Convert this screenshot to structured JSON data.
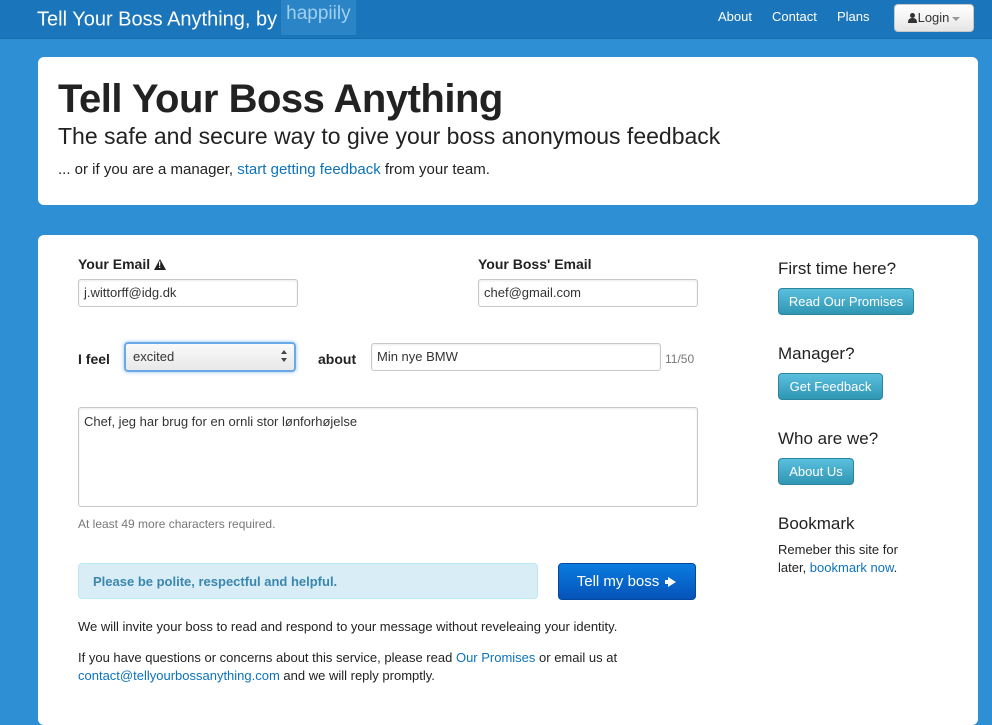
{
  "navbar": {
    "brand_text": "Tell Your Boss Anything, by",
    "brand_logo": "happiily",
    "links": [
      "About",
      "Contact",
      "Plans"
    ],
    "login_label": "Login"
  },
  "hero": {
    "title": "Tell Your Boss Anything",
    "subtitle": "The safe and secure way to give your boss anonymous feedback",
    "manager_prefix": "... or if you are a manager, ",
    "manager_link": "start getting feedback",
    "manager_suffix": " from your team."
  },
  "form": {
    "email_label": "Your Email",
    "email_value": "j.wittorff@idg.dk",
    "boss_email_label": "Your Boss' Email",
    "boss_email_value": "chef@gmail.com",
    "feel_label": "I feel",
    "feel_value": "excited",
    "about_label": "about",
    "about_value": "Min nye BMW",
    "char_count": "11/50",
    "message_value": "Chef, jeg har brug for en ornli stor lønforhøjelse",
    "min_chars_note": "At least 49 more characters required.",
    "alert_text": "Please be polite, respectful and helpful.",
    "submit_label": "Tell my boss",
    "invite_text": "We will invite your boss to read and respond to your message without reveleaing your identity.",
    "questions_prefix": "If you have questions or concerns about this service, please read ",
    "questions_link": "Our Promises",
    "questions_mid": " or email us at",
    "contact_email": "contact@tellyourbossanything.com",
    "questions_suffix": " and we will reply promptly."
  },
  "sidebar": {
    "first_time_heading": "First time here?",
    "promises_button": "Read Our Promises",
    "manager_heading": "Manager?",
    "feedback_button": "Get Feedback",
    "who_heading": "Who are we?",
    "about_button": "About Us",
    "bookmark_heading": "Bookmark",
    "bookmark_prefix": "Remeber this site for later, ",
    "bookmark_link": "bookmark now",
    "bookmark_suffix": "."
  },
  "colors": {
    "page_bg": "#2f8fd5",
    "navbar_bg": "#1b75bb",
    "link": "#0d73bd",
    "primary_button": "#0553b8",
    "info_button": "#2f96b4",
    "alert_bg": "#d9edf7"
  },
  "icons": [
    "user-icon",
    "caret-down-icon",
    "warning-icon",
    "select-arrows-icon",
    "megaphone-icon"
  ]
}
